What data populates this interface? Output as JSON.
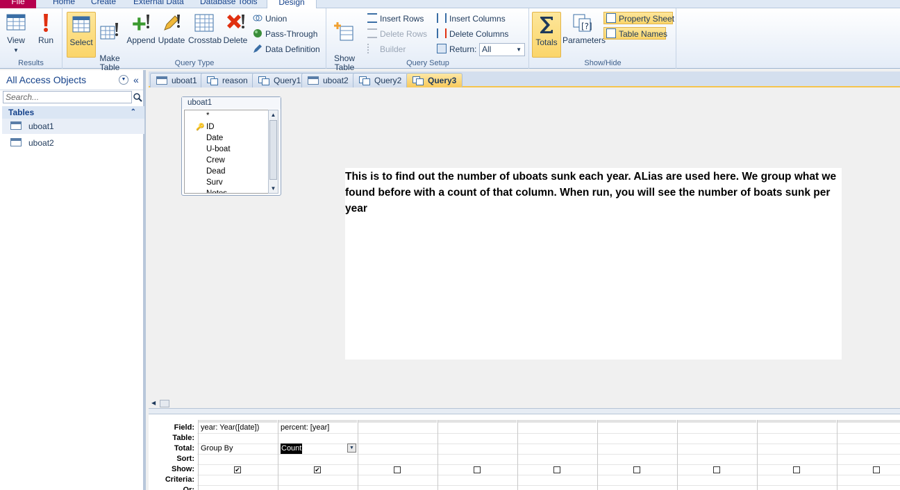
{
  "ribbon_tabs": [
    "File",
    "Home",
    "Create",
    "External Data",
    "Database Tools",
    "Design"
  ],
  "ribbon": {
    "results": {
      "label": "Results",
      "view": "View",
      "run": "Run"
    },
    "query_type": {
      "label": "Query Type",
      "select": "Select",
      "make_table": "Make\nTable",
      "append": "Append",
      "update": "Update",
      "crosstab": "Crosstab",
      "delete": "Delete",
      "union": "Union",
      "pass_through": "Pass-Through",
      "data_definition": "Data Definition"
    },
    "query_setup": {
      "label": "Query Setup",
      "show_table": "Show\nTable",
      "insert_rows": "Insert Rows",
      "delete_rows": "Delete Rows",
      "builder": "Builder",
      "insert_columns": "Insert Columns",
      "delete_columns": "Delete Columns",
      "return_label": "Return:",
      "return_value": "All"
    },
    "show_hide": {
      "label": "Show/Hide",
      "totals": "Totals",
      "parameters": "Parameters",
      "property_sheet": "Property Sheet",
      "table_names": "Table Names"
    }
  },
  "nav": {
    "title": "All Access Objects",
    "search_placeholder": "Search...",
    "section": "Tables",
    "items": [
      "uboat1",
      "uboat2"
    ]
  },
  "doc_tabs": [
    {
      "label": "uboat1",
      "kind": "table"
    },
    {
      "label": "reason",
      "kind": "query"
    },
    {
      "label": "Query1",
      "kind": "query"
    },
    {
      "label": "uboat2",
      "kind": "table"
    },
    {
      "label": "Query2",
      "kind": "query"
    },
    {
      "label": "Query3",
      "kind": "query",
      "active": true
    }
  ],
  "table_box": {
    "title": "uboat1",
    "fields": [
      "*",
      "ID",
      "Date",
      "U-boat",
      "Crew",
      "Dead",
      "Surv",
      "Notes"
    ]
  },
  "note_text": "This is to find out the number of uboats sunk each year. ALias are used here. We group what we found before with a count of that column. When run, you will see the number of boats sunk per year",
  "grid": {
    "row_labels": [
      "Field:",
      "Table:",
      "Total:",
      "Sort:",
      "Show:",
      "Criteria:",
      "Or:"
    ],
    "columns": [
      {
        "field": "year: Year([date])",
        "table": "",
        "total": "Group By",
        "show": true
      },
      {
        "field": "percent: [year]",
        "table": "",
        "total": "Count",
        "show": true
      },
      {
        "field": "",
        "table": "",
        "total": "",
        "show": false
      },
      {
        "field": "",
        "table": "",
        "total": "",
        "show": false
      },
      {
        "field": "",
        "table": "",
        "total": "",
        "show": false
      },
      {
        "field": "",
        "table": "",
        "total": "",
        "show": false
      },
      {
        "field": "",
        "table": "",
        "total": "",
        "show": false
      },
      {
        "field": "",
        "table": "",
        "total": "",
        "show": false
      },
      {
        "field": "",
        "table": "",
        "total": "",
        "show": false
      }
    ]
  }
}
